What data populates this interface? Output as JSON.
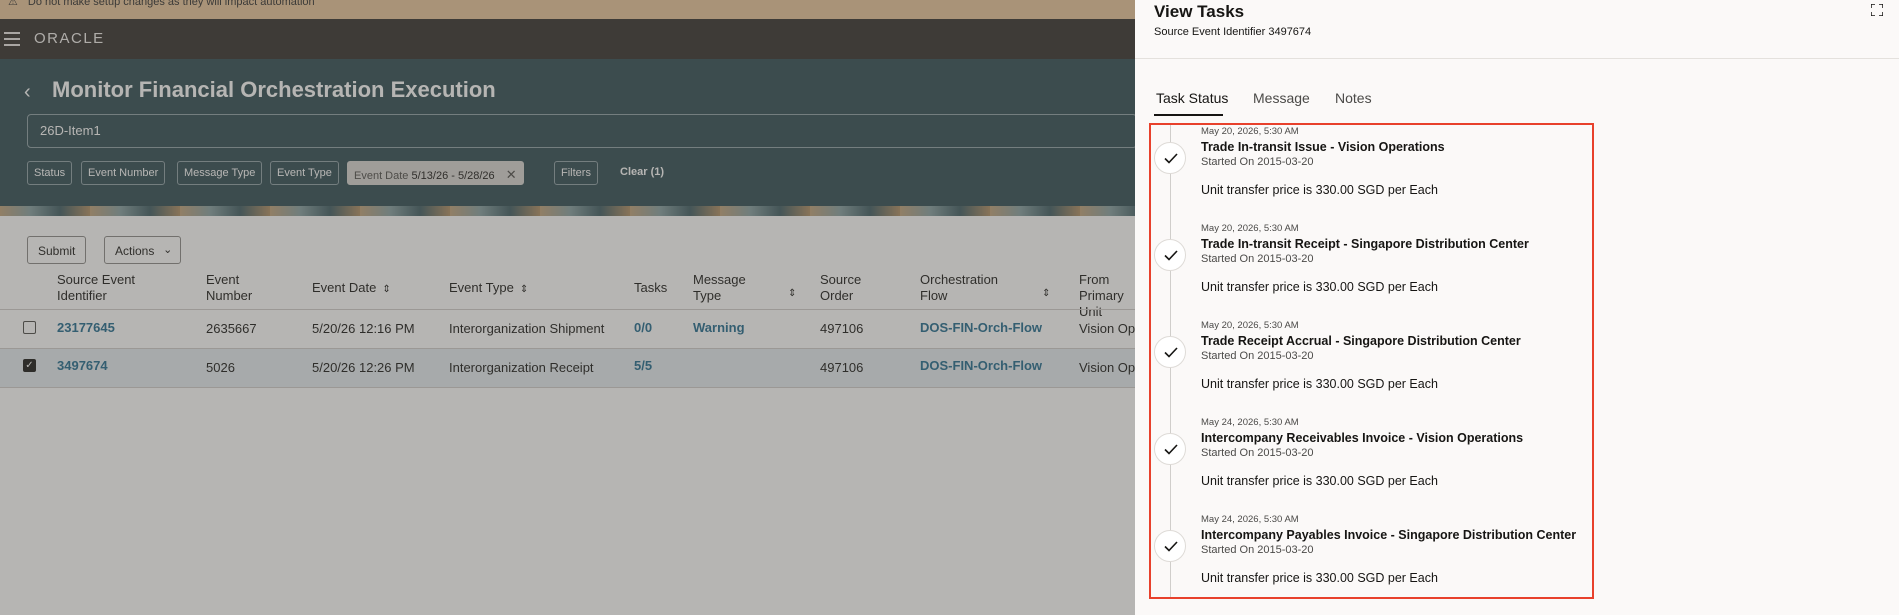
{
  "banner": {
    "text": "Do not make setup changes as they will impact automation"
  },
  "header": {
    "logo": "ORACLE"
  },
  "page": {
    "title": "Monitor Financial Orchestration Execution",
    "search_value": "26D-Item1"
  },
  "filters": {
    "status": "Status",
    "event_number": "Event Number",
    "message_type": "Message Type",
    "event_type": "Event Type",
    "event_date_label": "Event Date",
    "event_date_value": "5/13/26 - 5/28/26",
    "more": "Filters",
    "clear": "Clear (1)"
  },
  "toolbar": {
    "submit": "Submit",
    "actions": "Actions"
  },
  "table": {
    "headers": {
      "source_event_identifier": "Source Event Identifier",
      "event_number": "Event Number",
      "event_date": "Event Date",
      "event_type": "Event Type",
      "tasks": "Tasks",
      "message_type": "Message Type",
      "source_order": "Source Order",
      "orchestration_flow": "Orchestration Flow",
      "from_primary_unit": "From Primary Unit"
    },
    "rows": [
      {
        "selected": false,
        "source_event_identifier": "23177645",
        "event_number": "2635667",
        "event_date": "5/20/26 12:16 PM",
        "event_type": "Interorganization Shipment",
        "tasks": "0/0",
        "message_type": "Warning",
        "source_order": "497106",
        "orchestration_flow": "DOS-FIN-Orch-Flow",
        "from_primary_unit": "Vision Op"
      },
      {
        "selected": true,
        "source_event_identifier": "3497674",
        "event_number": "5026",
        "event_date": "5/20/26 12:26 PM",
        "event_type": "Interorganization Receipt",
        "tasks": "5/5",
        "message_type": "",
        "source_order": "497106",
        "orchestration_flow": "DOS-FIN-Orch-Flow",
        "from_primary_unit": "Vision Op"
      }
    ]
  },
  "drawer": {
    "title": "View Tasks",
    "subtitle": "Source Event Identifier 3497674",
    "tabs": [
      "Task Status",
      "Message",
      "Notes"
    ],
    "active_tab": "Task Status",
    "tasks": [
      {
        "timestamp": "May 20, 2026, 5:30 AM",
        "name": "Trade In-transit Issue - Vision Operations",
        "started": "Started On 2015-03-20",
        "message": "Unit transfer price is 330.00 SGD per Each"
      },
      {
        "timestamp": "May 20, 2026, 5:30 AM",
        "name": "Trade In-transit Receipt - Singapore Distribution Center",
        "started": "Started On 2015-03-20",
        "message": "Unit transfer price is 330.00 SGD per Each"
      },
      {
        "timestamp": "May 20, 2026, 5:30 AM",
        "name": "Trade Receipt Accrual - Singapore Distribution Center",
        "started": "Started On 2015-03-20",
        "message": "Unit transfer price is 330.00 SGD per Each"
      },
      {
        "timestamp": "May 24, 2026, 5:30 AM",
        "name": "Intercompany Receivables Invoice - Vision Operations",
        "started": "Started On 2015-03-20",
        "message": "Unit transfer price is 330.00 SGD per Each"
      },
      {
        "timestamp": "May 24, 2026, 5:30 AM",
        "name": "Intercompany Payables Invoice - Singapore Distribution Center",
        "started": "Started On 2015-03-20",
        "message": "Unit transfer price is 330.00 SGD per Each"
      }
    ]
  },
  "colors": {
    "highlight": "#e8412c",
    "link": "#1f6a8e",
    "header_bg": "#312d2a",
    "hero_bg": "#2e4a52"
  },
  "icons": [
    "warning-icon",
    "hamburger-icon",
    "back-arrow-icon",
    "close-icon",
    "chevron-down-icon",
    "sort-icon",
    "expand-icon",
    "check-icon"
  ]
}
